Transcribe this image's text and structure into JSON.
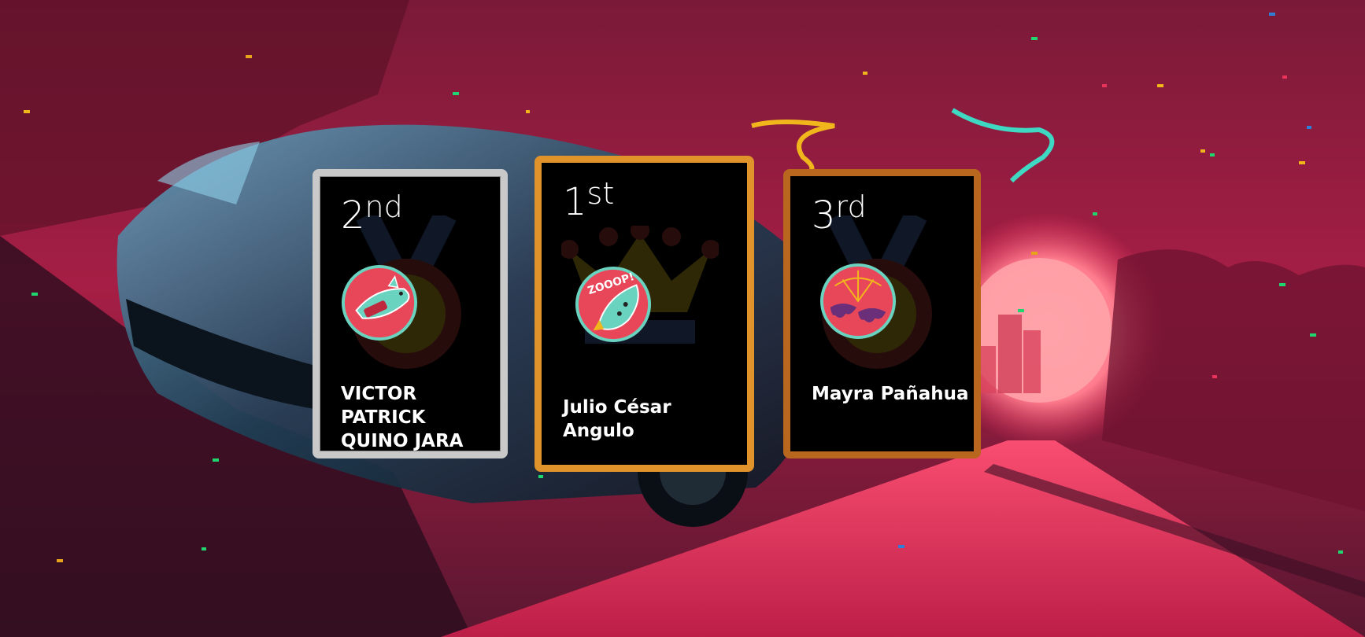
{
  "podium": {
    "second": {
      "ordinal_number": "2",
      "ordinal_suffix": "nd",
      "player_name": "VICTOR PATRICK QUINO JARA",
      "border_color": "#c9c9c9",
      "avatar_icon": "shark-rocket-icon"
    },
    "first": {
      "ordinal_number": "1",
      "ordinal_suffix": "st",
      "player_name": "Julio César Angulo",
      "border_color": "#e0922b",
      "avatar_icon": "zooop-rocket-icon",
      "avatar_text": "ZOOOP!"
    },
    "third": {
      "ordinal_number": "3",
      "ordinal_suffix": "rd",
      "player_name": "Mayra Pañahua",
      "border_color": "#b9661f",
      "avatar_icon": "bat-web-icon"
    }
  },
  "background": {
    "theme": "synthwave-car-road",
    "accent": "#e8335b",
    "sun": "#ff9a9a"
  }
}
